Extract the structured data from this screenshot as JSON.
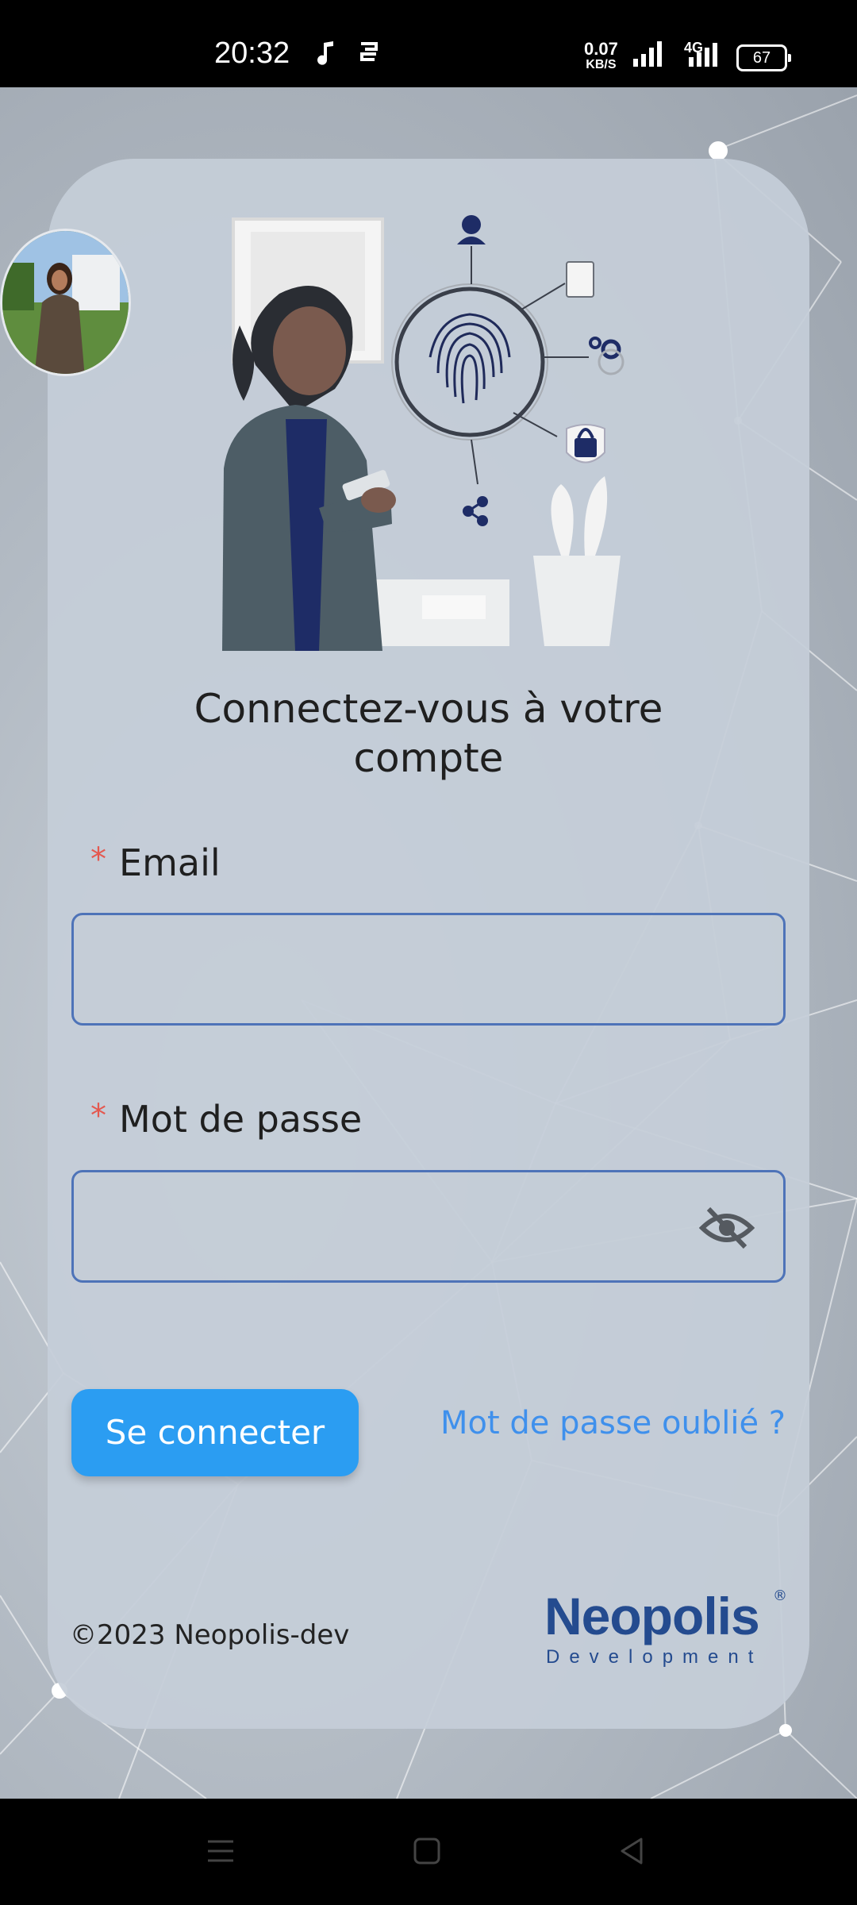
{
  "status_bar": {
    "time": "20:32",
    "net_speed_value": "0.07",
    "net_speed_unit": "KB/S",
    "network_type": "4G",
    "battery": "67"
  },
  "login": {
    "title": "Connectez-vous à votre compte",
    "email_label": "Email",
    "email_value": "",
    "password_label": "Mot de passe",
    "password_value": "",
    "required_mark": "*",
    "login_button": "Se connecter",
    "forgot_link": "Mot de passe oublié ?"
  },
  "footer": {
    "copyright": "©2023 Neopolis-dev",
    "brand_name": "Neopolis",
    "brand_sub": "Development",
    "brand_reg": "®"
  },
  "colors": {
    "primary_button": "#2b9df2",
    "link": "#3f90ec",
    "field_border": "#4e73b8",
    "required": "#e4584f",
    "brand": "#244b8f"
  }
}
